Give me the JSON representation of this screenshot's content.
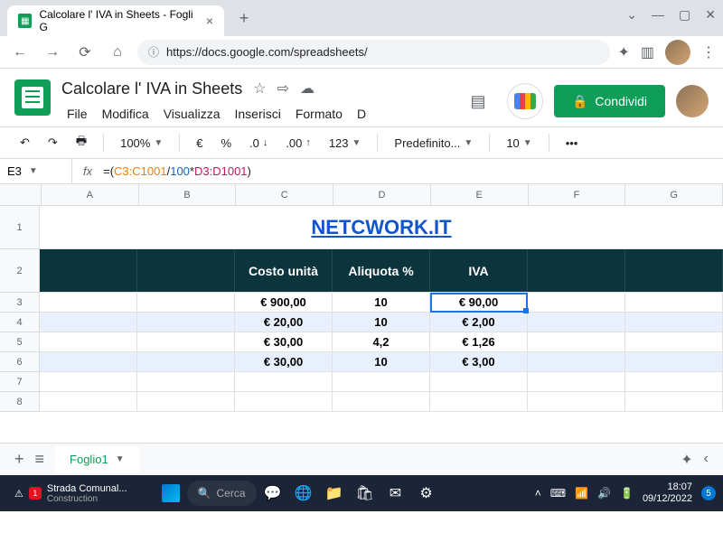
{
  "browser": {
    "tab_title": "Calcolare l' IVA in Sheets - Fogli G",
    "url": "https://docs.google.com/spreadsheets/"
  },
  "doc": {
    "title": "Calcolare l' IVA in Sheets",
    "menus": [
      "File",
      "Modifica",
      "Visualizza",
      "Inserisci",
      "Formato",
      "D"
    ],
    "share_label": "Condividi"
  },
  "toolbar": {
    "zoom": "100%",
    "currency": "€",
    "percent": "%",
    "dec_dec": ".0",
    "inc_dec": ".00",
    "format": "123",
    "font": "Predefinito...",
    "size": "10"
  },
  "formula_bar": {
    "cell_ref": "E3",
    "formula_parts": {
      "ref1": "C3:C1001",
      "num": "100",
      "ref2": "D3:D1001"
    }
  },
  "sheet": {
    "columns": [
      "A",
      "B",
      "C",
      "D",
      "E",
      "F",
      "G"
    ],
    "title_text": "NETCWORK.IT",
    "headers": {
      "c": "Costo unità",
      "d": "Aliquota %",
      "e": "IVA"
    },
    "rows": [
      {
        "c": "€ 900,00",
        "d": "10",
        "e": "€ 90,00"
      },
      {
        "c": "€ 20,00",
        "d": "10",
        "e": "€ 2,00"
      },
      {
        "c": "€ 30,00",
        "d": "4,2",
        "e": "€ 1,26"
      },
      {
        "c": "€ 30,00",
        "d": "10",
        "e": "€ 3,00"
      }
    ],
    "tab_name": "Foglio1"
  },
  "taskbar": {
    "weather_app": "Strada Comunal...",
    "weather_sub": "Construction",
    "search_placeholder": "Cerca",
    "time": "18:07",
    "date": "09/12/2022",
    "notif_count": "5",
    "badge": "1"
  }
}
